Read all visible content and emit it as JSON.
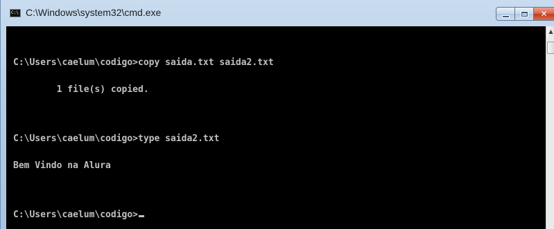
{
  "window": {
    "title": "C:\\Windows\\system32\\cmd.exe",
    "icon_name": "cmd-icon",
    "icon_glyph": "C:\\"
  },
  "caption_buttons": {
    "minimize_icon": "minimize-icon",
    "maximize_icon": "maximize-icon",
    "close_icon": "close-icon",
    "close_glyph": "✕"
  },
  "console": {
    "lines": [
      "C:\\Users\\caelum\\codigo>copy saida.txt saida2.txt",
      "        1 file(s) copied.",
      "C:\\Users\\caelum\\codigo>type saida2.txt",
      "Bem Vindo na Alura",
      "C:\\Users\\caelum\\codigo>"
    ],
    "colors": {
      "background": "#000000",
      "foreground": "#c0c0c0"
    }
  },
  "scrollbar": {
    "up_arrow_glyph": "▲"
  }
}
